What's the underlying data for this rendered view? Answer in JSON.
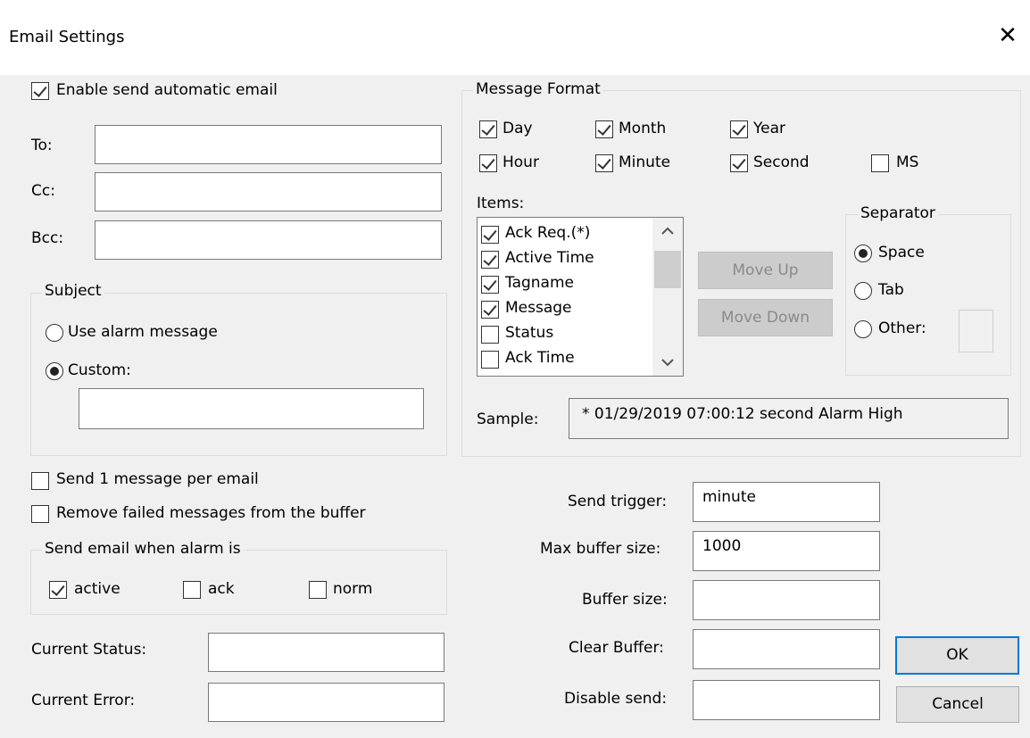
{
  "window": {
    "title": "Email Settings",
    "close_glyph": "✕"
  },
  "enable_auto_email": {
    "label": "Enable send automatic email",
    "checked": true
  },
  "recipients": {
    "to": {
      "label": "To:",
      "value": ""
    },
    "cc": {
      "label": "Cc:",
      "value": ""
    },
    "bcc": {
      "label": "Bcc:",
      "value": ""
    }
  },
  "subject": {
    "group_label": "Subject",
    "use_alarm_label": "Use alarm message",
    "custom_label": "Custom:",
    "selected": "custom",
    "custom_value": ""
  },
  "options": {
    "one_per_email": {
      "label": "Send 1 message per email",
      "checked": false
    },
    "remove_failed": {
      "label": "Remove failed messages from the buffer",
      "checked": false
    }
  },
  "send_when": {
    "group_label": "Send email when alarm is",
    "active": {
      "label": "active",
      "checked": true
    },
    "ack": {
      "label": "ack",
      "checked": false
    },
    "norm": {
      "label": "norm",
      "checked": false
    }
  },
  "status": {
    "current_status": {
      "label": "Current Status:",
      "value": ""
    },
    "current_error": {
      "label": "Current Error:",
      "value": ""
    }
  },
  "message_format": {
    "group_label": "Message Format",
    "day": {
      "label": "Day",
      "checked": true
    },
    "month": {
      "label": "Month",
      "checked": true
    },
    "year": {
      "label": "Year",
      "checked": true
    },
    "hour": {
      "label": "Hour",
      "checked": true
    },
    "minute": {
      "label": "Minute",
      "checked": true
    },
    "second": {
      "label": "Second",
      "checked": true
    },
    "ms": {
      "label": "MS",
      "checked": false
    },
    "items_label": "Items:",
    "items": [
      {
        "label": "Ack Req.(*)",
        "checked": true
      },
      {
        "label": "Active Time",
        "checked": true
      },
      {
        "label": "Tagname",
        "checked": true
      },
      {
        "label": "Message",
        "checked": true
      },
      {
        "label": "Status",
        "checked": false
      },
      {
        "label": "Ack Time",
        "checked": false
      }
    ],
    "move_up_label": "Move Up",
    "move_down_label": "Move Down",
    "separator": {
      "group_label": "Separator",
      "space_label": "Space",
      "tab_label": "Tab",
      "other_label": "Other:",
      "selected": "space",
      "other_value": ""
    },
    "sample_label": "Sample:",
    "sample_value": "* 01/29/2019 07:00:12 second Alarm High"
  },
  "buffer": {
    "send_trigger": {
      "label": "Send trigger:",
      "value": "minute"
    },
    "max_buffer_size": {
      "label": "Max buffer size:",
      "value": "1000"
    },
    "buffer_size": {
      "label": "Buffer size:",
      "value": ""
    },
    "clear_buffer": {
      "label": "Clear Buffer:",
      "value": ""
    },
    "disable_send": {
      "label": "Disable send:",
      "value": ""
    }
  },
  "buttons": {
    "ok": "OK",
    "cancel": "Cancel"
  },
  "icons": {
    "close": "close-icon",
    "scroll_up": "chevron-up-icon",
    "scroll_down": "chevron-down-icon"
  }
}
